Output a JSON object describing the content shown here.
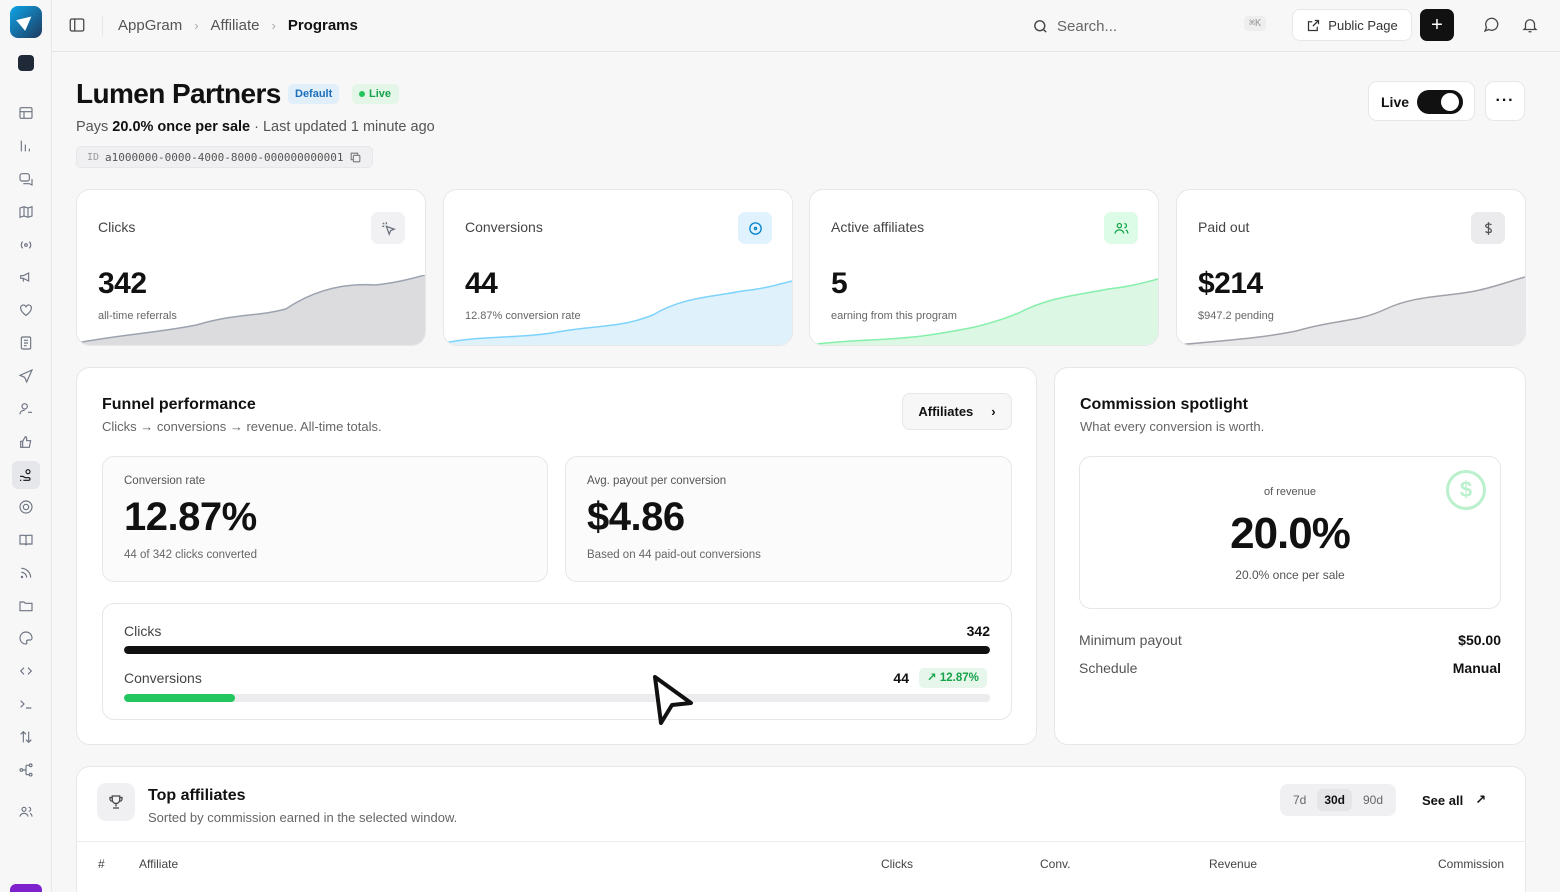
{
  "topbar": {
    "breadcrumbs": [
      "AppGram",
      "Affiliate",
      "Programs"
    ],
    "search_placeholder": "Search...",
    "search_shortcut": "⌘K",
    "public_page_label": "Public Page",
    "plus_label": "+"
  },
  "header": {
    "title": "Lumen Partners",
    "badge_default": "Default",
    "badge_live": "Live",
    "pays_prefix": "Pays",
    "pays_rate": "20.0% once per sale",
    "last_updated": "· Last updated 1 minute ago",
    "id_label": "ID",
    "id_value": "a1000000-0000-4000-8000-000000000001",
    "live_toggle_label": "Live",
    "live_on": true,
    "more_label": "···"
  },
  "stats": [
    {
      "label": "Clicks",
      "value": "342",
      "sub": "all-time referrals",
      "icon": "pointer-click-icon",
      "color": "#6b7280"
    },
    {
      "label": "Conversions",
      "value": "44",
      "sub": "12.87% conversion rate",
      "icon": "target-icon",
      "color": "#38bdf8"
    },
    {
      "label": "Active affiliates",
      "value": "5",
      "sub": "earning from this program",
      "icon": "users-icon",
      "color": "#4ade80"
    },
    {
      "label": "Paid out",
      "value": "$214",
      "sub": "$947.2 pending",
      "icon": "dollar-icon",
      "color": "#9ca3af"
    }
  ],
  "funnel": {
    "title": "Funnel performance",
    "subtitle": "Clicks → conversions → revenue. All-time totals.",
    "affiliates_button": "Affiliates",
    "conversion_rate": {
      "label": "Conversion rate",
      "value": "12.87%",
      "sub": "44 of 342 clicks converted"
    },
    "avg_payout": {
      "label": "Avg. payout per conversion",
      "value": "$4.86",
      "sub": "Based on 44 paid-out conversions"
    },
    "bars": {
      "clicks_label": "Clicks",
      "clicks_value": "342",
      "clicks_fraction": 1.0,
      "conversions_label": "Conversions",
      "conversions_value": "44",
      "conversions_fraction": 0.1287,
      "conversion_chip": "↗ 12.87%"
    },
    "colors": {
      "clicks": "#111111",
      "conversions": "#22c55e"
    }
  },
  "spotlight": {
    "title": "Commission spotlight",
    "subtitle": "What every conversion is worth.",
    "of_revenue": "of revenue",
    "rate": "20.0%",
    "rate_sub": "20.0% once per sale",
    "min_payout_label": "Minimum payout",
    "min_payout_value": "$50.00",
    "schedule_label": "Schedule",
    "schedule_value": "Manual"
  },
  "top_affiliates": {
    "title": "Top affiliates",
    "subtitle": "Sorted by commission earned in the selected window.",
    "ranges": [
      "7d",
      "30d",
      "90d"
    ],
    "active_range": "30d",
    "see_all": "See all",
    "columns": [
      "#",
      "Affiliate",
      "Clicks",
      "Conv.",
      "Revenue",
      "Commission"
    ]
  }
}
